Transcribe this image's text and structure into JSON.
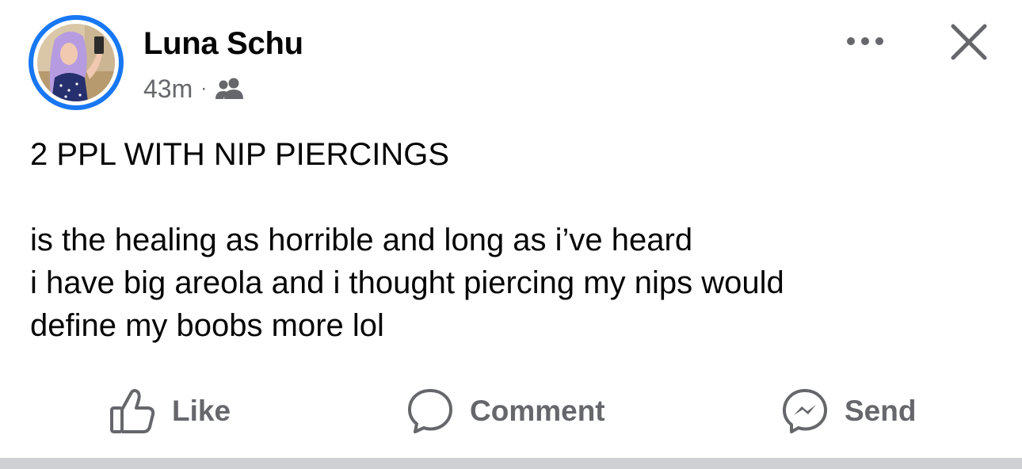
{
  "post": {
    "author_name": "Luna Schu",
    "timestamp": "43m",
    "separator": "·",
    "audience_icon": "friends-icon",
    "more_icon": "more-horizontal-icon",
    "close_icon": "close-icon",
    "text_lines": [
      "2 PPL WITH NIP PIERCINGS",
      "",
      "is the healing as horrible and long as i’ve heard",
      "i have big areola and i thought piercing my nips would",
      "define my boobs more lol"
    ]
  },
  "actions": {
    "like_label": "Like",
    "comment_label": "Comment",
    "send_label": "Send",
    "like_icon": "thumbs-up-icon",
    "comment_icon": "comment-icon",
    "send_icon": "messenger-icon"
  },
  "colors": {
    "story_ring": "#1877f2",
    "secondary_text": "#65676b",
    "primary_text": "#050505",
    "divider": "#ced0d4"
  }
}
